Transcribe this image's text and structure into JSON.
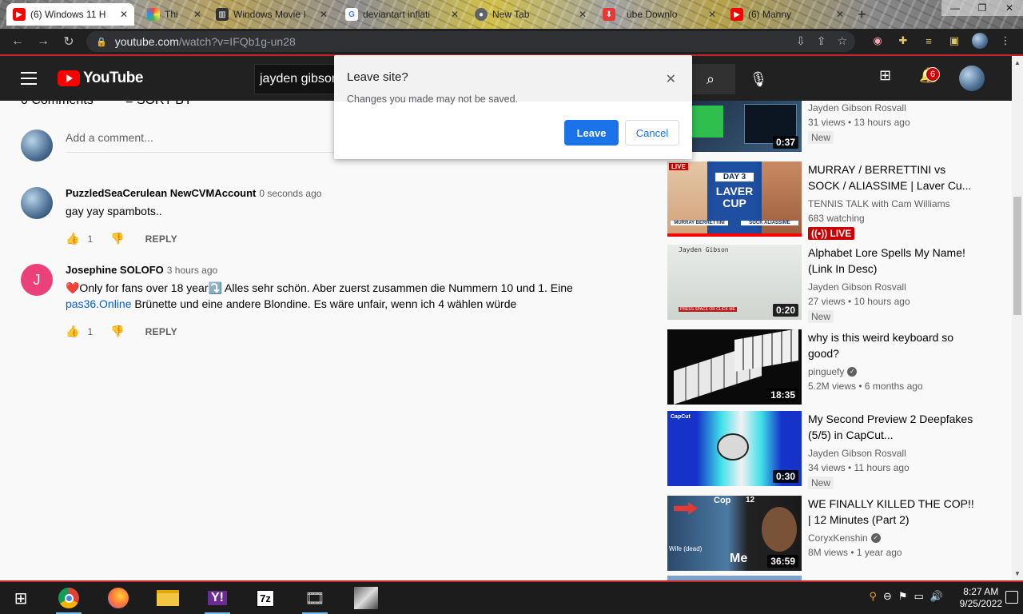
{
  "browser": {
    "tabs": [
      {
        "label": "(6) Windows 11 H",
        "favicon": "youtube-icon",
        "active": true
      },
      {
        "label": "Thi",
        "favicon": "colorful-icon",
        "active": false
      },
      {
        "label": "Windows Movie I",
        "favicon": "archive-icon",
        "active": false
      },
      {
        "label": "deviantart inflati",
        "favicon": "google-icon",
        "active": false
      },
      {
        "label": "New Tab",
        "favicon": "chrome-icon",
        "active": false
      },
      {
        "label": "ube Downlo",
        "favicon": "download-icon",
        "active": false
      },
      {
        "label": "(6) Manny",
        "favicon": "youtube-icon",
        "active": false
      }
    ],
    "new_tab": "+",
    "url_host": "youtube.com",
    "url_path": "/watch?v=IFQb1g-un28"
  },
  "youtube": {
    "logo_text": "YouTube",
    "search_value": "jayden gibson r",
    "notifications_count": "6"
  },
  "dialog": {
    "title": "Leave site?",
    "message": "Changes you made may not be saved.",
    "leave_label": "Leave",
    "cancel_label": "Cancel"
  },
  "comments": {
    "header_count": "0 Comments",
    "sort_label": "SORT BY",
    "placeholder": "Add a comment...",
    "items": [
      {
        "author": "PuzzledSeaCerulean NewCVMAccount",
        "time": "0 seconds ago",
        "text": "gay yay spambots..",
        "likes": "1",
        "reply": "REPLY"
      },
      {
        "author": "Josephine SOLOFO",
        "time": "3 hours ago",
        "avatar_letter": "J",
        "text_before": "❤️Only for fans over 18 year⤵️ Alles sehr schön. Aber zuerst zusammen die Nummern 10 und 1. Eine",
        "link": "pas36.Online",
        "text_after": " Brünette und eine andere Blondine. Es wäre unfair, wenn ich 4 wählen würde",
        "likes": "1",
        "reply": "REPLY"
      }
    ]
  },
  "sidebar": {
    "videos": [
      {
        "title": "",
        "channel": "Jayden Gibson Rosvall",
        "meta": "31 views • 13 hours ago",
        "badge": "New",
        "duration": "0:37"
      },
      {
        "title": "MURRAY / BERRETTINI vs SOCK / ALIASSIME | Laver Cu...",
        "channel": "TENNIS TALK with Cam Williams",
        "meta": "683 watching",
        "badge": "LIVE",
        "thumb_text_1": "DAY 3",
        "thumb_text_2": "LAVER CUP",
        "thumb_text_3": "MURRAY BERRETTINI",
        "thumb_text_4": "SOCK ALIASSIME",
        "thumb_live": "LIVE"
      },
      {
        "title": "Alphabet Lore Spells My Name! (Link In Desc)",
        "channel": "Jayden Gibson Rosvall",
        "meta": "27 views • 10 hours ago",
        "badge": "New",
        "duration": "0:20",
        "thumb_text_1": "Jayden Gibson",
        "thumb_text_2": "PRESS SPACE OR CLICK ME"
      },
      {
        "title": "why is this weird keyboard so good?",
        "channel": "pinguefy",
        "meta": "5.2M views • 6 months ago",
        "verified": true,
        "duration": "18:35"
      },
      {
        "title": "My Second Preview 2 Deepfakes (5/5) in CapCut...",
        "channel": "Jayden Gibson Rosvall",
        "meta": "34 views • 11 hours ago",
        "badge": "New",
        "duration": "0:30",
        "thumb_text_1": "CapCut"
      },
      {
        "title": "WE FINALLY KILLED THE COP!! | 12 Minutes (Part 2)",
        "channel": "CoryxKenshin",
        "meta": "8M views • 1 year ago",
        "verified": true,
        "duration": "36:59",
        "thumb_text_1": "Cop",
        "thumb_text_2": "Me",
        "thumb_text_3": "Wife (dead)",
        "thumb_text_4": "12"
      }
    ]
  },
  "taskbar": {
    "time": "8:27 AM",
    "date": "9/25/2022",
    "apps": [
      "windows-start",
      "chrome",
      "firefox",
      "file-explorer",
      "yahoo",
      "7zip",
      "movie-maker",
      "app"
    ]
  },
  "colors": {
    "accent_red": "#c8242a",
    "youtube_red": "#ff0000",
    "dialog_blue": "#1a73e8",
    "link_blue": "#065fd4"
  }
}
